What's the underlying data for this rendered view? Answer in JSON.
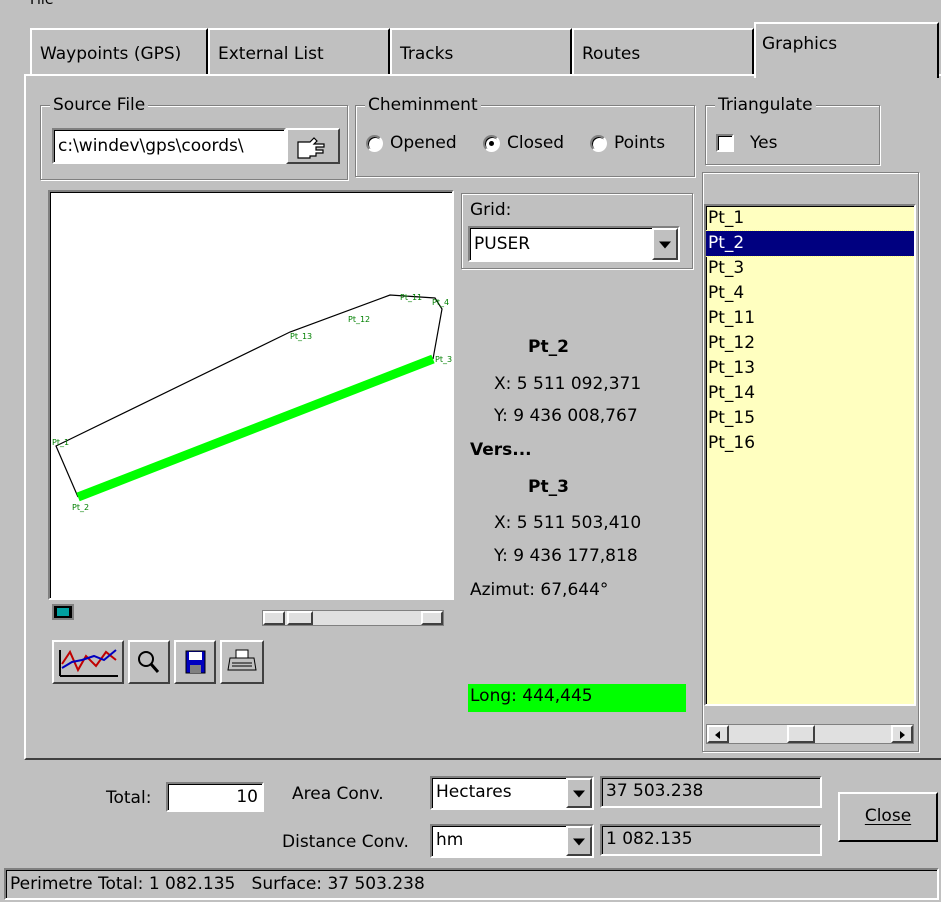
{
  "tabs": [
    {
      "label": "Waypoints (GPS)"
    },
    {
      "label": "External List"
    },
    {
      "label": "Tracks"
    },
    {
      "label": "Routes"
    },
    {
      "label": "Graphics"
    }
  ],
  "active_tab": "Graphics",
  "source_file": {
    "legend": "Source File",
    "value": "c:\\windev\\gps\\coords\\"
  },
  "cheminment": {
    "legend": "Cheminment",
    "options": [
      "Opened",
      "Closed",
      "Points"
    ],
    "selected": "Closed"
  },
  "triangulate": {
    "legend": "Triangulate",
    "checkbox_label": "Yes",
    "checked": false
  },
  "grid": {
    "label": "Grid:",
    "value": "PUSER"
  },
  "info": {
    "from_name": "Pt_2",
    "from_x": "X: 5 511 092,371",
    "from_y": "Y: 9 436 008,767",
    "vers": "Vers...",
    "to_name": "Pt_3",
    "to_x": "X: 5 511 503,410",
    "to_y": "Y: 9 436 177,818",
    "azimut": "Azimut: 67,644°",
    "long": "Long: 444,445"
  },
  "points": [
    "Pt_1",
    "Pt_2",
    "Pt_3",
    "Pt_4",
    "Pt_11",
    "Pt_12",
    "Pt_13",
    "Pt_14",
    "Pt_15",
    "Pt_16"
  ],
  "selected_point": "Pt_2",
  "map_labels": {
    "pt1": "Pt_1",
    "pt2": "Pt_2",
    "pt3": "Pt_3",
    "pt4": "Pt_4",
    "pt11": "Pt_11",
    "pt12": "Pt_12",
    "pt13": "Pt_13"
  },
  "bottom": {
    "total_label": "Total:",
    "total_value": "10",
    "area_label": "Area Conv.",
    "area_unit": "Hectares",
    "area_value": "37 503.238",
    "distance_label": "Distance Conv.",
    "distance_unit": "hm",
    "distance_value": "1 082.135",
    "close_label": "Close"
  },
  "status_bar": "Perimetre Total: 1 082.135   Surface: 37 503.238",
  "colors": {
    "highlight": "#00ff00",
    "list_bg": "#ffffc0",
    "selection": "#000080"
  }
}
